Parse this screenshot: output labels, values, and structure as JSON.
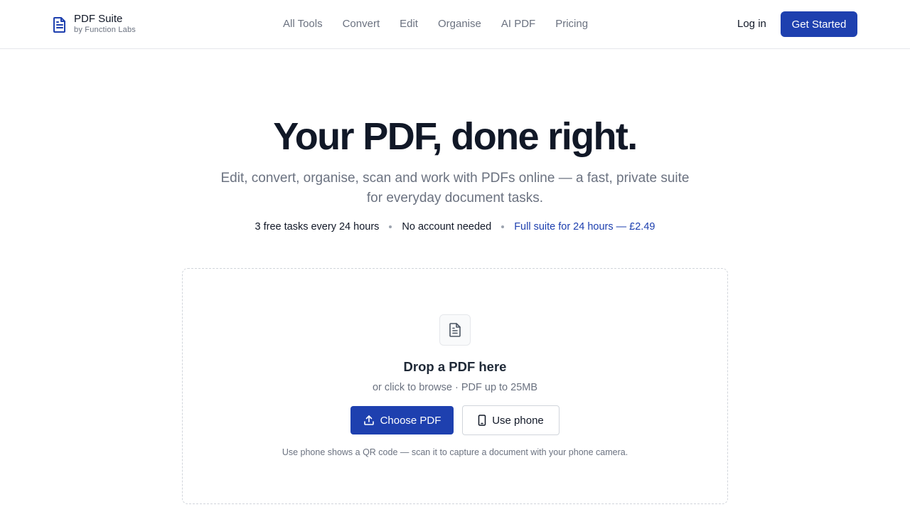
{
  "brand": {
    "name": "PDF Suite",
    "subtitle": "by Function Labs",
    "icon": "document-icon",
    "accent": "#1e40af"
  },
  "nav": {
    "items": [
      {
        "label": "All Tools"
      },
      {
        "label": "Convert"
      },
      {
        "label": "Edit"
      },
      {
        "label": "Organise"
      },
      {
        "label": "AI PDF"
      },
      {
        "label": "Pricing"
      }
    ]
  },
  "header_actions": {
    "login_label": "Log in",
    "cta_label": "Get Started"
  },
  "hero": {
    "title": "Your PDF, done right.",
    "subtitle": "Edit, convert, organise, scan and work with PDFs online — a fast, private suite for everyday document tasks.",
    "badges": [
      "3 free tasks every 24 hours",
      "No account needed"
    ],
    "badge_link": "Full suite for 24 hours — £2.49"
  },
  "dropzone": {
    "icon": "file-text-icon",
    "title": "Drop a PDF here",
    "subtitle": "or click to browse · PDF up to 25MB",
    "choose_label": "Choose PDF",
    "choose_icon": "upload-icon",
    "phone_label": "Use phone",
    "phone_icon": "smartphone-icon",
    "note": "Use phone shows a QR code — scan it to capture a document with your phone camera."
  },
  "colors": {
    "primary": "#1e40af",
    "text": "#111827",
    "muted": "#6b7280",
    "border": "#e5e7eb"
  }
}
